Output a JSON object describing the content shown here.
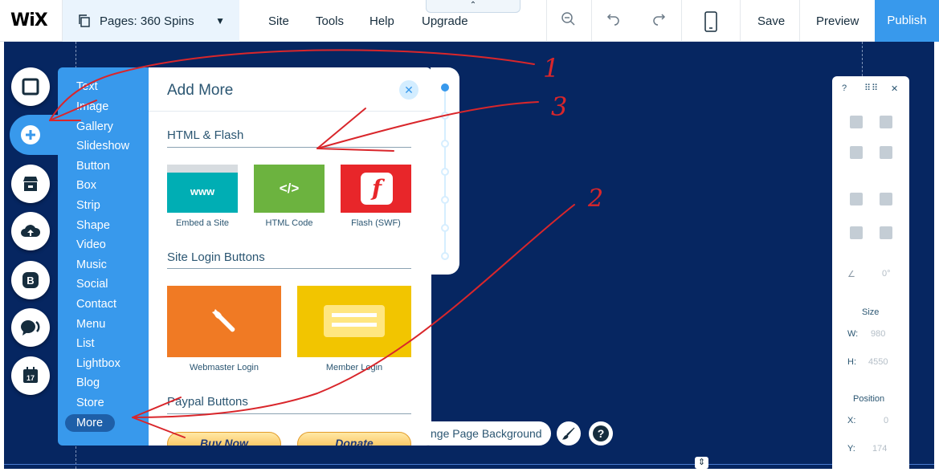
{
  "topbar": {
    "logo": "WiX",
    "pages_label": "Pages: 360 Spins",
    "menu": [
      "Site",
      "Tools",
      "Help",
      "Upgrade"
    ],
    "save": "Save",
    "preview": "Preview",
    "publish": "Publish"
  },
  "add_menu": {
    "items": [
      "Text",
      "Image",
      "Gallery",
      "Slideshow",
      "Button",
      "Box",
      "Strip",
      "Shape",
      "Video",
      "Music",
      "Social",
      "Contact",
      "Menu",
      "List",
      "Lightbox",
      "Blog",
      "Store",
      "More"
    ],
    "selected": "More"
  },
  "add_panel": {
    "title": "Add More",
    "sections": {
      "html_flash": {
        "title": "HTML & Flash",
        "tiles": [
          {
            "caption": "Embed a Site",
            "glyph": "www",
            "color": "#00aeb4"
          },
          {
            "caption": "HTML Code",
            "glyph": "</>",
            "color": "#6cb33f"
          },
          {
            "caption": "Flash (SWF)",
            "glyph": "f",
            "color": "#e8262a"
          }
        ]
      },
      "site_login": {
        "title": "Site Login Buttons",
        "tiles": [
          {
            "caption": "Webmaster Login",
            "color": "#f07a24"
          },
          {
            "caption": "Member Login",
            "color": "#f2c500"
          }
        ]
      },
      "paypal": {
        "title": "Paypal Buttons",
        "buttons": [
          "Buy Now",
          "Donate"
        ]
      }
    }
  },
  "canvas_controls": {
    "change_bg": "nge Page Background"
  },
  "right_panel": {
    "help": "?",
    "size_label": "Size",
    "w_label": "W:",
    "w_value": "980",
    "h_label": "H:",
    "h_value": "4550",
    "angle_value": "0°",
    "position_label": "Position",
    "x_label": "X:",
    "x_value": "0",
    "y_label": "Y:",
    "y_value": "174"
  },
  "annotations": {
    "n1": "1",
    "n2": "2",
    "n3": "3",
    "color": "#d9262b"
  }
}
